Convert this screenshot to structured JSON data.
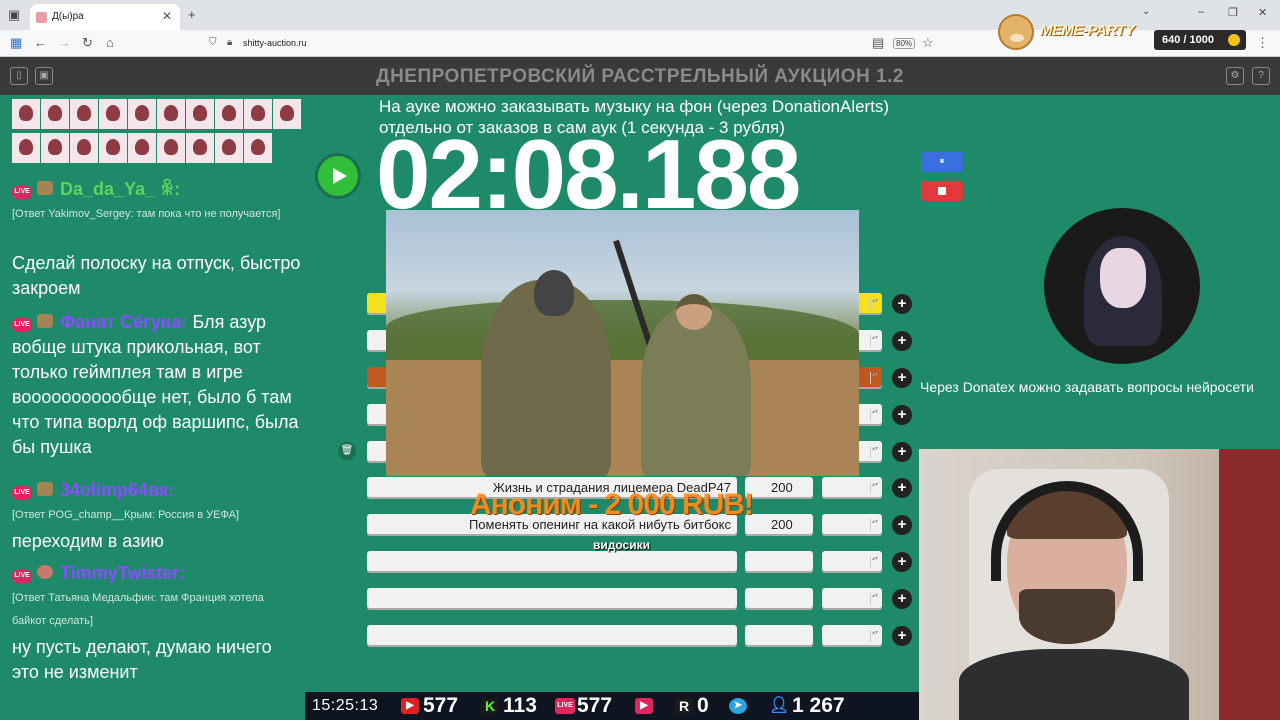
{
  "browser": {
    "tab_title": "Д(ы)ра",
    "url": "shitty-auction.ru",
    "zoom": "80%"
  },
  "meme_party": {
    "title": "MEME-PARTY",
    "count": "640 / 1000"
  },
  "app": {
    "title": "ДНЕПРОПЕТРОВСКИЙ РАССТРЕЛЬНЫЙ АУКЦИОН 1.2"
  },
  "chat": {
    "messages": [
      {
        "user": "Da_da_Ya_ ꆜ:",
        "user_color": "#5fd35f",
        "reply": "[Ответ Yakimov_Sergey: там пока что не получается]",
        "text": "Сделай полоску на отпуск, быстро закроем"
      },
      {
        "user": "Фанат Сёгуна:",
        "user_color": "#8a4dff",
        "reply": "",
        "text": "Бля азур вобще штука прикольная, вот только геймплея там в игре вооооооооообще нет, было б там что типа ворлд оф варшипс, была бы пушка"
      },
      {
        "user": "34olimp64вк:",
        "user_color": "#8a4dff",
        "reply": "[Ответ POG_champ__Крым: Россия в УЕФА]",
        "text": "переходим в азию"
      },
      {
        "user": "TimmyTwister:",
        "user_color": "#8a4dff",
        "reply": "[Ответ Татьяна Медальфин: там Франция хотела байкот сделать]",
        "text": "ну пусть делают, думаю ничего это не изменит"
      }
    ]
  },
  "auction": {
    "note_line1": "На ауке можно заказывать музыку на фон (через DonationAlerts)",
    "note_line2": "отдельно от заказов в сам аук (1 секунда - 3 рубля)",
    "timer": "02:08.188",
    "pause_icon": "⏸",
    "lots": [
      {
        "name": "",
        "amount": "",
        "highlight": "#f5e020"
      },
      {
        "name": "",
        "amount": "",
        "highlight": ""
      },
      {
        "name": "",
        "amount": "",
        "highlight": "#c0581f"
      },
      {
        "name": "",
        "amount": "",
        "highlight": ""
      },
      {
        "name": "",
        "amount": "",
        "highlight": ""
      },
      {
        "name": "Жизнь и страдания лицемера DeadP47",
        "amount": "200",
        "highlight": ""
      },
      {
        "name": "Поменять опенинг на какой нибуть битбокс",
        "amount": "200",
        "highlight": ""
      },
      {
        "name": "",
        "amount": "",
        "highlight": ""
      },
      {
        "name": "",
        "amount": "",
        "highlight": ""
      },
      {
        "name": "",
        "amount": "",
        "highlight": ""
      }
    ],
    "plus_label": "+"
  },
  "donation": {
    "text": "Аноним - 2 000 RUB!",
    "subtext": "видосики"
  },
  "right": {
    "ai_note": "Через Donatex можно задавать вопросы нейросети"
  },
  "stats": {
    "time": "15:25:13",
    "youtube": "577",
    "kick": "113",
    "vk_live": "577",
    "rutube": "0",
    "viewers": "1 267"
  }
}
